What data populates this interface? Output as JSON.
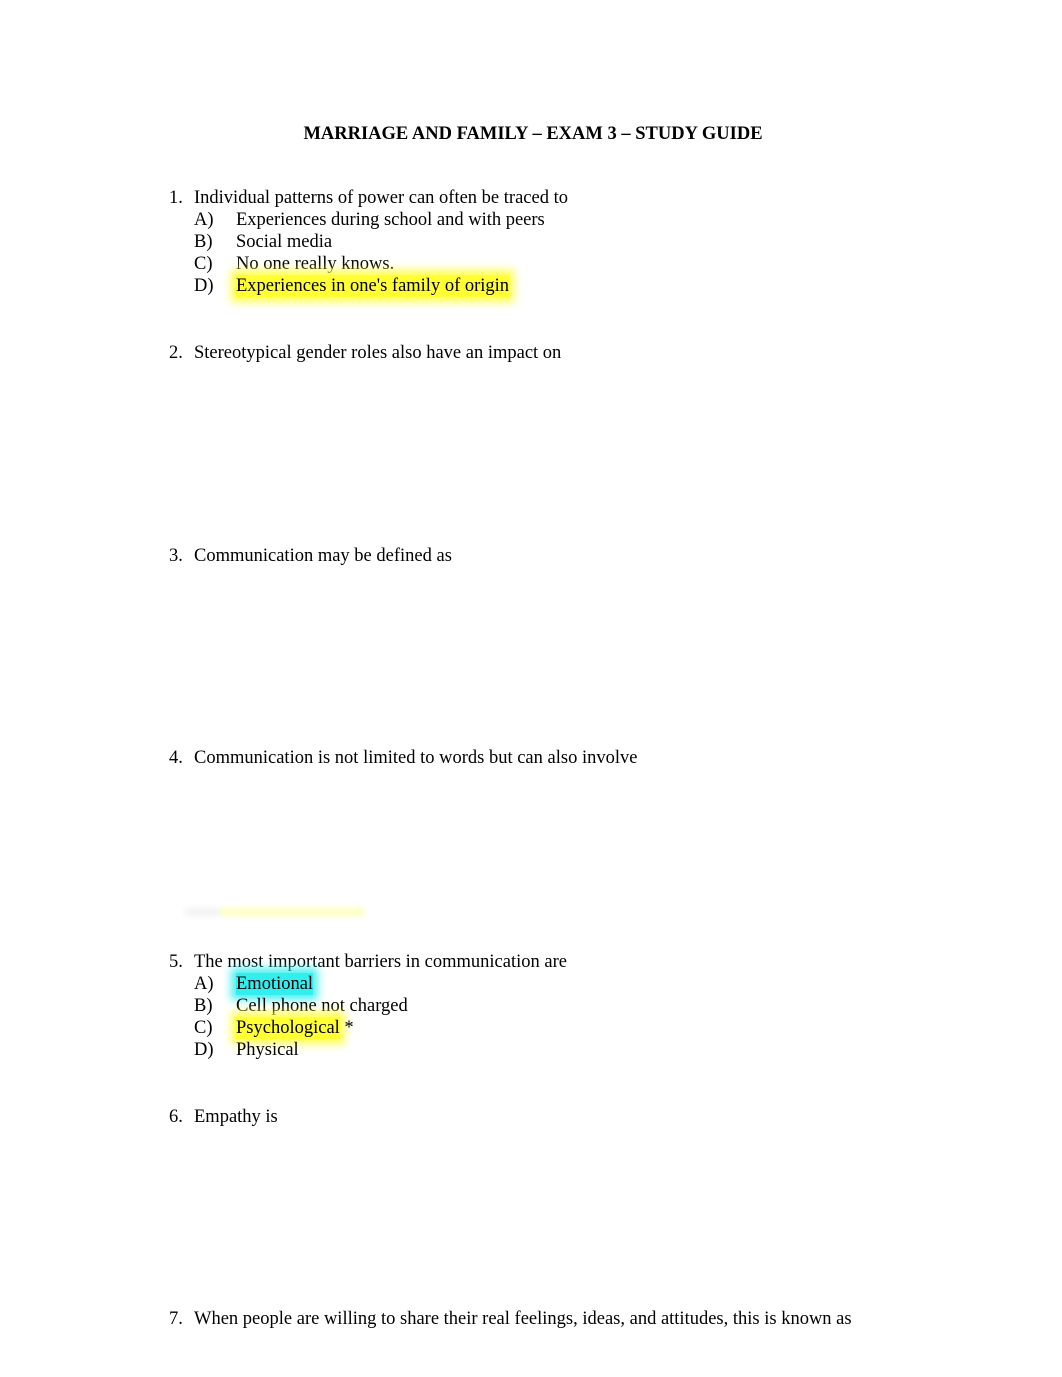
{
  "document": {
    "title": "MARRIAGE AND FAMILY – EXAM 3 – STUDY GUIDE",
    "highlight_colors": {
      "yellow": "#ffff33",
      "cyan": "#33eeee"
    },
    "questions": [
      {
        "number": "1.",
        "text": "Individual patterns of power can often be traced to",
        "options": [
          {
            "letter": "A)",
            "text": "Experiences during school and with peers",
            "highlight": "none"
          },
          {
            "letter": "B)",
            "text": "Social media",
            "highlight": "none"
          },
          {
            "letter": "C)",
            "text": "No one really knows.",
            "highlight": "none"
          },
          {
            "letter": "D)",
            "text": "Experiences in one's family of origin",
            "highlight": "yellow"
          }
        ]
      },
      {
        "number": "2.",
        "text": "Stereotypical gender roles also have an impact on",
        "options": []
      },
      {
        "number": "3.",
        "text": "Communication may be defined as",
        "options": []
      },
      {
        "number": "4.",
        "text": "Communication is not limited to words but can also involve",
        "options": []
      },
      {
        "number": "5.",
        "text": "The most important barriers in communication are",
        "options": [
          {
            "letter": "A)",
            "text": "Emotional",
            "highlight": "cyan"
          },
          {
            "letter": "B)",
            "text": "Cell phone not charged",
            "highlight": "none"
          },
          {
            "letter": "C)",
            "text": "Psychological",
            "suffix": " *",
            "highlight": "yellow"
          },
          {
            "letter": "D)",
            "text": "Physical",
            "highlight": "none"
          }
        ]
      },
      {
        "number": "6.",
        "text": "Empathy is",
        "options": []
      },
      {
        "number": "7.",
        "text": "When people are willing to share their real feelings, ideas, and attitudes, this is known as",
        "options": []
      }
    ]
  }
}
